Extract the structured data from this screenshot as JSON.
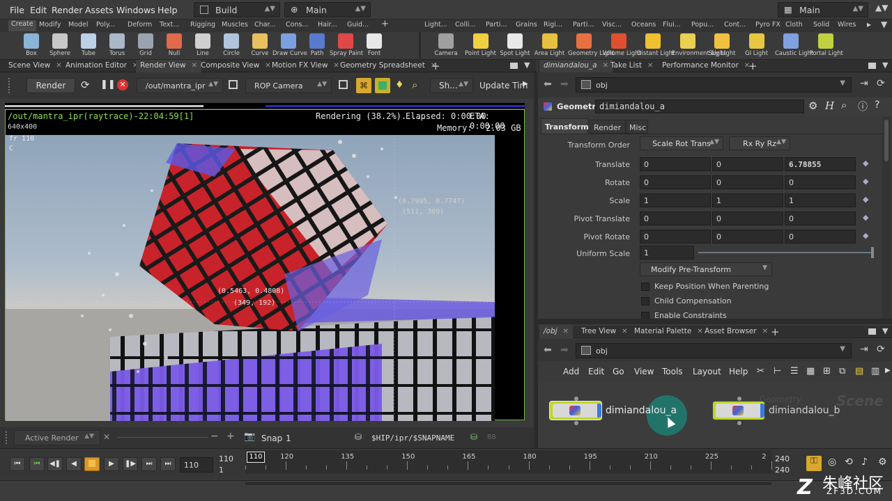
{
  "menubar": {
    "items": [
      "File",
      "Edit",
      "Render",
      "Assets",
      "Windows",
      "Help"
    ],
    "desktop": "Build",
    "context": "Main",
    "right_desktop": "Main"
  },
  "shelf_tabs_left": [
    "Create",
    "Modify",
    "Model",
    "Poly...",
    "Deform",
    "Text...",
    "Rigging",
    "Muscles",
    "Char...",
    "Cons...",
    "Hair...",
    "Guid..."
  ],
  "shelf_tabs_right": [
    "Light...",
    "Colli...",
    "Parti...",
    "Grains",
    "Rigi...",
    "Parti...",
    "Visc...",
    "Oceans",
    "Flui...",
    "Popu...",
    "Cont...",
    "Pyro FX",
    "Cloth",
    "Solid",
    "Wires"
  ],
  "tools_left": [
    {
      "label": "Box",
      "color": "#8ab4d8"
    },
    {
      "label": "Sphere",
      "color": "#c8c8c8"
    },
    {
      "label": "Tube",
      "color": "#bcd0e6"
    },
    {
      "label": "Torus",
      "color": "#aab8c8"
    },
    {
      "label": "Grid",
      "color": "#9aa4b0"
    },
    {
      "label": "Null",
      "color": "#e06a4a"
    },
    {
      "label": "Line",
      "color": "#d0d0d0"
    },
    {
      "label": "Circle",
      "color": "#b0c4dc"
    },
    {
      "label": "Curve",
      "color": "#e8c060"
    },
    {
      "label": "Draw Curve",
      "color": "#7aa0e0"
    },
    {
      "label": "Path",
      "color": "#5a7ad0"
    },
    {
      "label": "Spray Paint",
      "color": "#e04848"
    },
    {
      "label": "Font",
      "color": "#e8e8e8"
    }
  ],
  "tools_right": [
    {
      "label": "Camera",
      "color": "#a0a0a0"
    },
    {
      "label": "Point Light",
      "color": "#f0d040"
    },
    {
      "label": "Spot Light",
      "color": "#e8e8e8"
    },
    {
      "label": "Area Light",
      "color": "#e8c040"
    },
    {
      "label": "Geometry Light",
      "color": "#e87040"
    },
    {
      "label": "Volume Light",
      "color": "#e05030"
    },
    {
      "label": "Distant Light",
      "color": "#f0c030"
    },
    {
      "label": "Environment Light",
      "color": "#e8d050"
    },
    {
      "label": "Sky Light",
      "color": "#f0c040"
    },
    {
      "label": "GI Light",
      "color": "#e8c840"
    },
    {
      "label": "Caustic Light",
      "color": "#80a0e0"
    },
    {
      "label": "Portal Light",
      "color": "#c0d040"
    }
  ],
  "left_tabs": [
    "Scene View",
    "Animation Editor",
    "Render View",
    "Composite View",
    "Motion FX View",
    "Geometry Spreadsheet"
  ],
  "render_toolbar": {
    "render_label": "Render",
    "rop_path": "/out/mantra_ipr",
    "camera": "ROP Camera",
    "shading": "Sh...",
    "update_label": "Update Tim"
  },
  "viewport": {
    "header_left": "/out/mantra_ipr(raytrace)-22:04:59[1]",
    "resolution": "640x400",
    "frame": "fr 110",
    "channel": "C",
    "status": "Rendering (38.2%).....",
    "elapsed": "Elapsed: 0:00:00",
    "eta": "ETA: 0:00:00",
    "memory_label": "Memory:",
    "memory_value": "2.03 GB",
    "progress": 0.382,
    "probe1_uv": "(0.7995, 0.7747)",
    "probe1_px": "(511, 309)",
    "probe2_uv": "(0.5463, 0.4808)",
    "probe2_px": "(349, 192)"
  },
  "viewport_bottom": {
    "active_render": "Active Render",
    "snap_label": "Snap",
    "snap_value": "1",
    "snap_path": "$HIP/ipr/$SNAPNAME",
    "snap_num": "88"
  },
  "right_top_tabs": [
    "dimiandalou_a",
    "Take List",
    "Performance Monitor"
  ],
  "param": {
    "path": "obj",
    "type": "Geometry",
    "name": "dimiandalou_a",
    "tabs": [
      "Transform",
      "Render",
      "Misc"
    ],
    "transform_order_label": "Transform Order",
    "transform_order": "Scale Rot Trans",
    "rot_order": "Rx Ry Rz",
    "rows": [
      {
        "label": "Translate",
        "v": [
          "0",
          "0",
          "6.78855"
        ]
      },
      {
        "label": "Rotate",
        "v": [
          "0",
          "0",
          "0"
        ]
      },
      {
        "label": "Scale",
        "v": [
          "1",
          "1",
          "1"
        ]
      },
      {
        "label": "Pivot Translate",
        "v": [
          "0",
          "0",
          "0"
        ]
      },
      {
        "label": "Pivot Rotate",
        "v": [
          "0",
          "0",
          "0"
        ]
      }
    ],
    "uniform_scale_label": "Uniform Scale",
    "uniform_scale": "1",
    "modify_pretransform": "Modify Pre-Transform",
    "checks": [
      "Keep Position When Parenting",
      "Child Compensation",
      "Enable Constraints"
    ]
  },
  "network_tabs": [
    "/obj",
    "Tree View",
    "Material Palette",
    "Asset Browser"
  ],
  "network": {
    "path": "obj",
    "menu": [
      "Add",
      "Edit",
      "Go",
      "View",
      "Tools",
      "Layout",
      "Help"
    ],
    "context_label": "Scene",
    "faded_label": "Geometry",
    "nodes": [
      {
        "name": "dimiandalou_a"
      },
      {
        "name": "dimiandalou_b"
      }
    ]
  },
  "timeline": {
    "current_frame": "110",
    "start": "110",
    "start2": "1",
    "ticks": [
      "110",
      "120",
      "135",
      "150",
      "165",
      "180",
      "195",
      "210",
      "225",
      "2"
    ],
    "end": "240",
    "end2": "240"
  },
  "watermark": {
    "cn": "朱峰社区",
    "url": "ZF3D.COM"
  }
}
